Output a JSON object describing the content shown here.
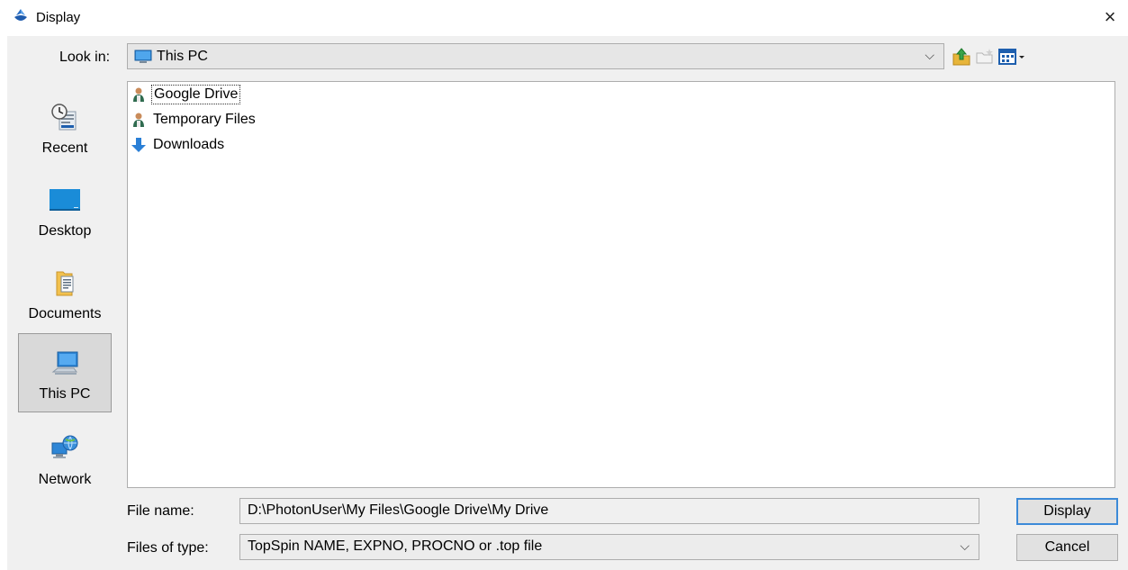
{
  "window": {
    "title": "Display",
    "close_glyph": "×"
  },
  "lookin": {
    "label": "Look in:",
    "value": "This PC"
  },
  "places": [
    {
      "label": "Recent",
      "icon": "recent-icon"
    },
    {
      "label": "Desktop",
      "icon": "desktop-icon"
    },
    {
      "label": "Documents",
      "icon": "documents-icon"
    },
    {
      "label": "This PC",
      "icon": "computer-icon",
      "selected": true
    },
    {
      "label": "Network",
      "icon": "network-icon"
    }
  ],
  "files": [
    {
      "name": "Google Drive",
      "icon": "user-folder-icon",
      "focused": true
    },
    {
      "name": "Temporary Files",
      "icon": "user-folder-icon"
    },
    {
      "name": "Downloads",
      "icon": "download-arrow-icon"
    }
  ],
  "filename": {
    "label": "File name:",
    "value": "D:\\PhotonUser\\My Files\\Google Drive\\My Drive"
  },
  "filetype": {
    "label": "Files of type:",
    "value": "TopSpin NAME, EXPNO, PROCNO or .top file"
  },
  "buttons": {
    "display": "Display",
    "cancel": "Cancel"
  },
  "colors": {
    "accent": "#3c8ad8",
    "dialog_bg": "#f0f0f0"
  }
}
